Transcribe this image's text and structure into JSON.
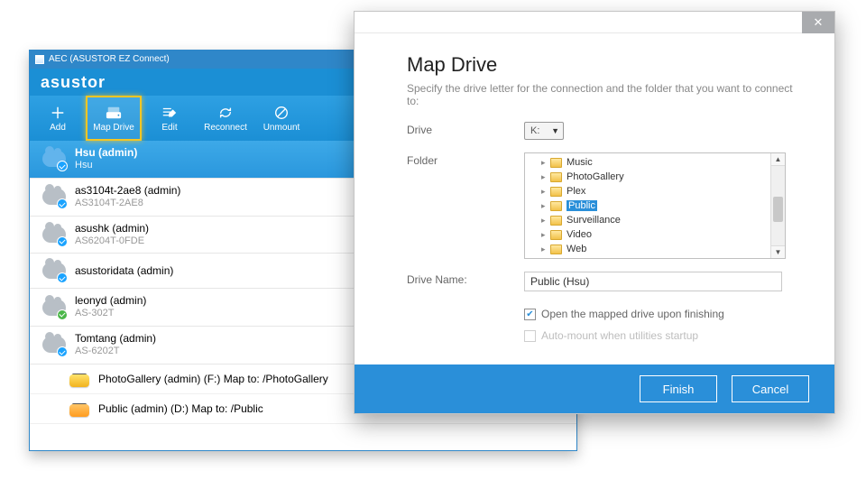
{
  "aec": {
    "title": "AEC (ASUSTOR EZ Connect)",
    "brand": "asustor",
    "toolbar": [
      {
        "label": "Add"
      },
      {
        "label": "Map Drive"
      },
      {
        "label": "Edit"
      },
      {
        "label": "Reconnect"
      },
      {
        "label": "Unmount"
      }
    ],
    "nas": [
      {
        "name": "Hsu (admin)",
        "sub": "Hsu",
        "active": true,
        "badge": "blue"
      },
      {
        "name": "as3104t-2ae8 (admin)",
        "sub": "AS3104T-2AE8",
        "badge": "blue"
      },
      {
        "name": "asushk (admin)",
        "sub": "AS6204T-0FDE",
        "badge": "blue"
      },
      {
        "name": "asustoridata (admin)",
        "sub": "",
        "badge": "blue"
      },
      {
        "name": "leonyd (admin)",
        "sub": "AS-302T",
        "badge": "green"
      },
      {
        "name": "Tomtang (admin)",
        "sub": "AS-6202T",
        "badge": "blue"
      }
    ],
    "shares": [
      {
        "name": "PhotoGallery (admin) (F:)",
        "path": "Map to: /PhotoGallery",
        "color": "yellow"
      },
      {
        "name": "Public (admin) (D:)",
        "path": "Map to: /Public",
        "color": "orange"
      }
    ]
  },
  "dialog": {
    "title": "Map Drive",
    "desc": "Specify the drive letter for the connection and the folder that you want to connect to:",
    "labels": {
      "drive": "Drive",
      "folder": "Folder",
      "driveName": "Drive Name:"
    },
    "drive": "K:",
    "folders": [
      "Music",
      "PhotoGallery",
      "Plex",
      "Public",
      "Surveillance",
      "Video",
      "Web"
    ],
    "selectedFolder": "Public",
    "driveName": "Public (Hsu)",
    "check1": "Open the mapped drive upon finishing",
    "check2": "Auto-mount when utilities startup",
    "finish": "Finish",
    "cancel": "Cancel"
  }
}
